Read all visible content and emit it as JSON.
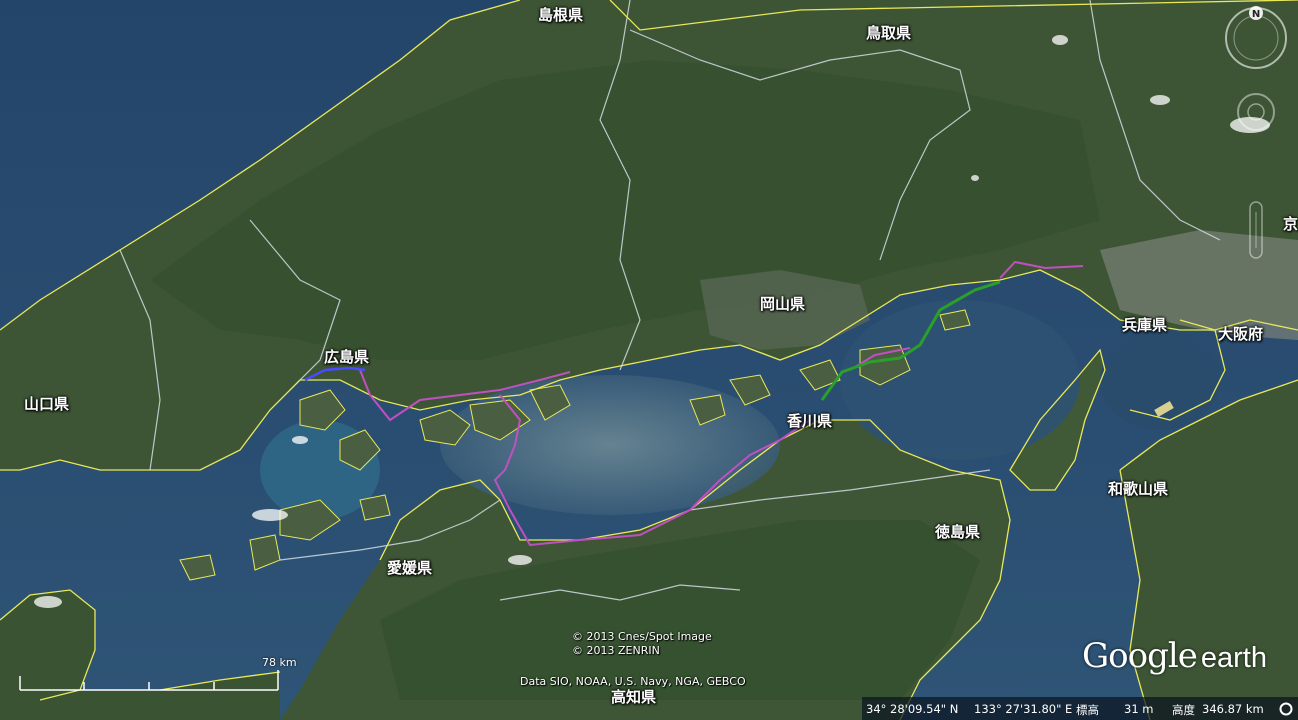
{
  "map": {
    "prefectures": [
      {
        "id": "shimane",
        "label": "島根県"
      },
      {
        "id": "tottori",
        "label": "鳥取県"
      },
      {
        "id": "okayama",
        "label": "岡山県"
      },
      {
        "id": "hyogo",
        "label": "兵庫県"
      },
      {
        "id": "osaka",
        "label": "大阪府"
      },
      {
        "id": "hiroshima",
        "label": "広島県"
      },
      {
        "id": "yamaguchi",
        "label": "山口県"
      },
      {
        "id": "kagawa",
        "label": "香川県"
      },
      {
        "id": "wakayama",
        "label": "和歌山県"
      },
      {
        "id": "tokushima",
        "label": "徳島県"
      },
      {
        "id": "ehime",
        "label": "愛媛県"
      },
      {
        "id": "kochi",
        "label": "高知県"
      },
      {
        "id": "kyoto_partial",
        "label": "京"
      }
    ],
    "colors": {
      "border": "#e8e85a",
      "route_magenta": "#c050c0",
      "route_green": "#2aa02a",
      "route_blue": "#4a4aff",
      "sea": "#2b4d70",
      "land": "#3b5233"
    }
  },
  "attribution": {
    "line1": "© 2013 Cnes/Spot Image",
    "line2": "© 2013 ZENRIN",
    "line3": "Data SIO, NOAA, U.S. Navy, NGA, GEBCO"
  },
  "scale": {
    "label": "78 km"
  },
  "logo": {
    "google": "Google",
    "earth": "earth"
  },
  "status": {
    "lat": "34° 28'09.54\" N",
    "lon": "133° 27'31.80\" E",
    "elev_label": "標高",
    "elev_value": "31 m",
    "alt_label": "高度",
    "alt_value": "346.87 km"
  },
  "nav": {
    "north": "N"
  }
}
